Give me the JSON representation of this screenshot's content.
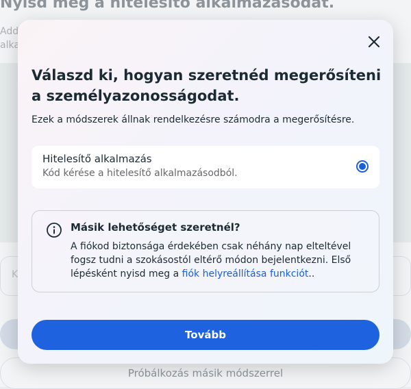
{
  "background": {
    "title": "Nyisd meg a hitelesítő alkalmazásodat.",
    "subtitle": "Add alka",
    "field_placeholder": "K",
    "secondary_button": "Próbálkozás másik módszerrel"
  },
  "modal": {
    "title": "Válaszd ki, hogyan szeretnéd megerősíteni a személyazonosságodat.",
    "subtitle": "Ezek a módszerek állnak rendelkezésre számodra a megerősítésre.",
    "option": {
      "title": "Hitelesítő alkalmazás",
      "description": "Kód kérése a hitelesítő alkalmazásodból.",
      "selected": true
    },
    "info": {
      "title": "Másik lehetőséget szeretnél?",
      "text": "A fiókod biztonsága érdekében csak néhány nap elteltével fogsz tudni a szokásostól eltérő módon bejelentkezni. Első lépésként nyisd meg a ",
      "link": "fiók helyreállítása funkciót",
      "text_end": ".."
    },
    "continue_button": "Tovább"
  },
  "colors": {
    "primary": "#1f62e0",
    "link": "#1a5fd6",
    "text": "#1c2b33"
  },
  "icons": {
    "close": "close-icon",
    "info": "info-icon",
    "radio": "radio-selected-icon"
  }
}
